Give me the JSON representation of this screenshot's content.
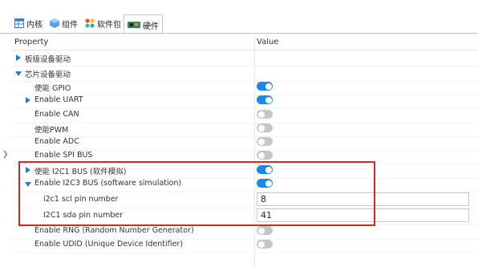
{
  "tabs": [
    {
      "label": "内核",
      "icon": "table-icon"
    },
    {
      "label": "组件",
      "icon": "cube-icon"
    },
    {
      "label": "软件包",
      "icon": "packages-icon"
    },
    {
      "label": "硬件",
      "icon": "board-icon"
    }
  ],
  "grid": {
    "header": {
      "property": "Property",
      "value": "Value"
    },
    "rows": [
      {
        "label": "板级设备驱动",
        "expander": "collapsed",
        "value": ""
      },
      {
        "label": "芯片设备驱动",
        "expander": "expanded",
        "value": ""
      },
      {
        "label": "使能 GPIO",
        "toggle": "on"
      },
      {
        "label": "Enable UART",
        "expander": "collapsed",
        "toggle": "on"
      },
      {
        "label": "Enable CAN",
        "toggle": "off"
      },
      {
        "label": "使能PWM",
        "toggle": "off"
      },
      {
        "label": "Enable ADC",
        "toggle": "off"
      },
      {
        "label": "Enable SPI BUS",
        "toggle": "off"
      },
      {
        "label": "使能 I2C1 BUS (软件模拟)",
        "expander": "collapsed",
        "toggle": "on"
      },
      {
        "label": "Enable I2C3 BUS (software simulation)",
        "expander": "expanded",
        "toggle": "on"
      },
      {
        "label": "i2c1 scl pin number",
        "value": "8"
      },
      {
        "label": "I2C1 sda pin number",
        "value": "41"
      },
      {
        "label": "Enable RNG (Random Number Generator)",
        "toggle": "off"
      },
      {
        "label": "Enable UDID (Unique Device Identifier)",
        "toggle": "off"
      }
    ]
  },
  "colors": {
    "accent": "#1e88e5",
    "highlight_box": "#d72828",
    "toggle_off": "#c6c6c6"
  }
}
